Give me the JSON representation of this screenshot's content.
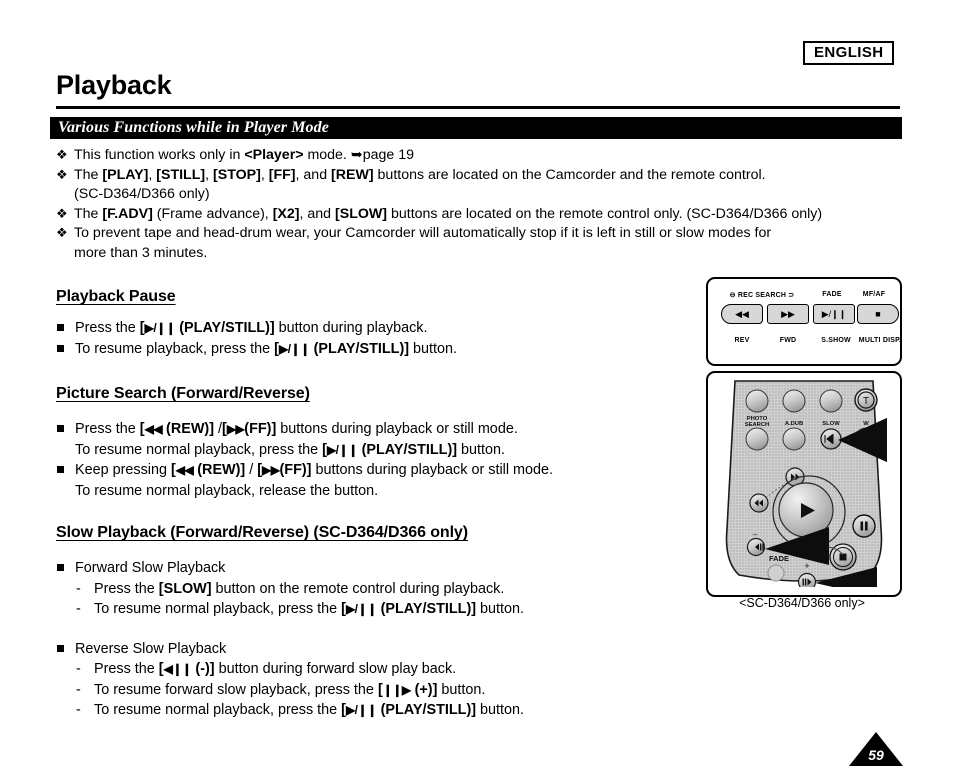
{
  "header": {
    "language_badge": "ENGLISH",
    "page_title": "Playback",
    "section_bar_title": "Various Functions while in Player Mode"
  },
  "intro_bullets": [
    {
      "bullet": "❖",
      "segments": [
        {
          "t": "This function works only in ",
          "b": false
        },
        {
          "t": "<Player>",
          "b": true
        },
        {
          "t": " mode. ",
          "b": false
        },
        {
          "t": "➥",
          "b": false
        },
        {
          "t": "page 19",
          "b": false
        }
      ]
    },
    {
      "bullet": "❖",
      "segments": [
        {
          "t": "The ",
          "b": false
        },
        {
          "t": "[PLAY]",
          "b": true
        },
        {
          "t": ", ",
          "b": false
        },
        {
          "t": "[STILL]",
          "b": true
        },
        {
          "t": ", ",
          "b": false
        },
        {
          "t": "[STOP]",
          "b": true
        },
        {
          "t": ", ",
          "b": false
        },
        {
          "t": "[FF]",
          "b": true
        },
        {
          "t": ", and ",
          "b": false
        },
        {
          "t": "[REW]",
          "b": true
        },
        {
          "t": " buttons are located on the Camcorder and the remote control.",
          "b": false
        }
      ],
      "continuation": "(SC-D364/D366 only)"
    },
    {
      "bullet": "❖",
      "segments": [
        {
          "t": "The ",
          "b": false
        },
        {
          "t": "[F.ADV]",
          "b": true
        },
        {
          "t": " (Frame advance), ",
          "b": false
        },
        {
          "t": "[X2]",
          "b": true
        },
        {
          "t": ", and ",
          "b": false
        },
        {
          "t": "[SLOW]",
          "b": true
        },
        {
          "t": " buttons are located on the remote control only. (SC-D364/D366 only)",
          "b": false
        }
      ]
    },
    {
      "bullet": "❖",
      "segments": [
        {
          "t": "To prevent tape and head-drum wear, your Camcorder will automatically stop if it is left in still or slow modes for",
          "b": false
        }
      ],
      "continuation": "more than 3 minutes."
    }
  ],
  "sections": [
    {
      "id": "playback-pause",
      "heading": "Playback Pause",
      "items": [
        {
          "kind": "square",
          "segments": [
            {
              "t": "Press the ",
              "b": false
            },
            {
              "t": "[",
              "b": true
            },
            {
              "t": "▶/❙❙",
              "b": true,
              "glyph": true
            },
            {
              "t": " (PLAY/STILL)]",
              "b": true
            },
            {
              "t": " button during playback.",
              "b": false
            }
          ]
        },
        {
          "kind": "square",
          "segments": [
            {
              "t": "To resume playback, press the ",
              "b": false
            },
            {
              "t": "[",
              "b": true
            },
            {
              "t": "▶/❙❙",
              "b": true,
              "glyph": true
            },
            {
              "t": " (PLAY/STILL)]",
              "b": true
            },
            {
              "t": " button.",
              "b": false
            }
          ]
        }
      ]
    },
    {
      "id": "picture-search",
      "heading": "Picture Search (Forward/Reverse)",
      "items": [
        {
          "kind": "square",
          "segments": [
            {
              "t": "Press the ",
              "b": false
            },
            {
              "t": "[",
              "b": true
            },
            {
              "t": "◀◀",
              "b": true,
              "glyph": true
            },
            {
              "t": " (REW)]",
              "b": true
            },
            {
              "t": " /",
              "b": false
            },
            {
              "t": "[",
              "b": true
            },
            {
              "t": "▶▶",
              "b": true,
              "glyph": true
            },
            {
              "t": "(FF)]",
              "b": true
            },
            {
              "t": " buttons during playback or still mode.",
              "b": false
            }
          ],
          "sub": [
            {
              "t": "To resume normal playback, press the ",
              "b": false
            },
            {
              "t": "[",
              "b": true
            },
            {
              "t": "▶/❙❙",
              "b": true,
              "glyph": true
            },
            {
              "t": " (PLAY/STILL)]",
              "b": true
            },
            {
              "t": " button.",
              "b": false
            }
          ]
        },
        {
          "kind": "square",
          "segments": [
            {
              "t": "Keep pressing ",
              "b": false
            },
            {
              "t": "[",
              "b": true
            },
            {
              "t": "◀◀",
              "b": true,
              "glyph": true
            },
            {
              "t": " (REW)]",
              "b": true
            },
            {
              "t": " / ",
              "b": false
            },
            {
              "t": "[",
              "b": true
            },
            {
              "t": "▶▶",
              "b": true,
              "glyph": true
            },
            {
              "t": "(FF)]",
              "b": true
            },
            {
              "t": " buttons during playback or still mode.",
              "b": false
            }
          ],
          "sub": [
            {
              "t": "To resume normal playback, release the button.",
              "b": false
            }
          ]
        }
      ]
    },
    {
      "id": "slow-playback",
      "heading": "Slow Playback (Forward/Reverse) (SC-D364/D366 only)",
      "items": [
        {
          "kind": "square",
          "segments": [
            {
              "t": "Forward Slow Playback",
              "b": false
            }
          ]
        },
        {
          "kind": "dash",
          "segments": [
            {
              "t": "Press the ",
              "b": false
            },
            {
              "t": "[SLOW]",
              "b": true
            },
            {
              "t": " button on the remote control during playback.",
              "b": false
            }
          ]
        },
        {
          "kind": "dash",
          "segments": [
            {
              "t": "To resume normal playback, press the ",
              "b": false
            },
            {
              "t": "[",
              "b": true
            },
            {
              "t": "▶/❙❙",
              "b": true,
              "glyph": true
            },
            {
              "t": " (PLAY/STILL)]",
              "b": true
            },
            {
              "t": " button.",
              "b": false
            }
          ]
        },
        {
          "kind": "square",
          "gap": true,
          "segments": [
            {
              "t": "Reverse Slow Playback",
              "b": false
            }
          ]
        },
        {
          "kind": "dash",
          "segments": [
            {
              "t": "Press the ",
              "b": false
            },
            {
              "t": "[",
              "b": true
            },
            {
              "t": "◀❙❙",
              "b": true,
              "glyph": true
            },
            {
              "t": " (-)]",
              "b": true
            },
            {
              "t": " button during forward slow play back.",
              "b": false
            }
          ]
        },
        {
          "kind": "dash",
          "segments": [
            {
              "t": "To resume forward slow playback, press the ",
              "b": false
            },
            {
              "t": "[",
              "b": true
            },
            {
              "t": "❙❙▶",
              "b": true,
              "glyph": true
            },
            {
              "t": " (+)]",
              "b": true
            },
            {
              "t": " button.",
              "b": false
            }
          ]
        },
        {
          "kind": "dash",
          "segments": [
            {
              "t": "To resume normal playback, press the ",
              "b": false
            },
            {
              "t": "[",
              "b": true
            },
            {
              "t": "▶/❙❙",
              "b": true,
              "glyph": true
            },
            {
              "t": " (PLAY/STILL)]",
              "b": true
            },
            {
              "t": " button.",
              "b": false
            }
          ]
        }
      ]
    }
  ],
  "camcorder_panel": {
    "top_labels": [
      "REC SEARCH",
      "FADE",
      "MF/AF"
    ],
    "top_label_rec_prefix": "⊖",
    "top_label_rec_suffix": "⊃",
    "buttons": [
      "◀◀",
      "▶▶",
      "▶/❙❙",
      "■"
    ],
    "bottom_labels": [
      "REV",
      "FWD",
      "S.SHOW",
      "MULTI DISP."
    ]
  },
  "remote": {
    "labels": [
      "PHOTO SEARCH",
      "A.DUB",
      "SLOW",
      "T",
      "W",
      "FADE",
      "+",
      "-"
    ],
    "caption": "<SC-D364/D366 only>"
  },
  "footer": {
    "page_number": "59"
  },
  "colors": {
    "ink": "#000000",
    "paper": "#ffffff",
    "button_fill": "#d7d7d7",
    "remote_fill": "#c9c9c9"
  }
}
